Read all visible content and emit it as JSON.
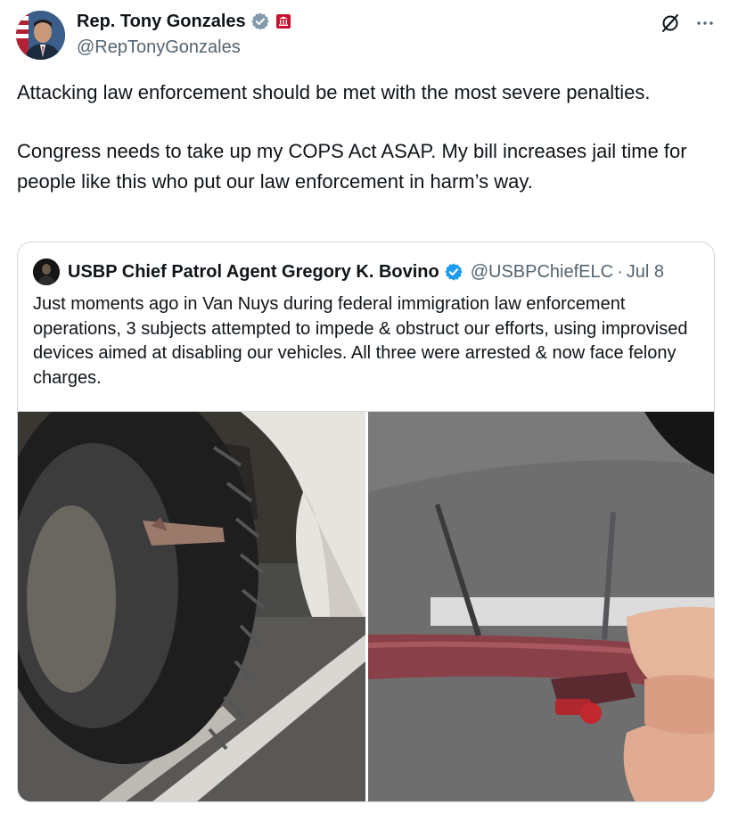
{
  "author": {
    "name": "Rep. Tony Gonzales",
    "handle": "@RepTonyGonzales"
  },
  "tweet": {
    "paragraph_1": "Attacking law enforcement should be met with the most severe penalties.",
    "paragraph_2": "Congress needs to take up my COPS Act ASAP. My bill increases jail time for people like this who put our law enforcement in harm’s way."
  },
  "quoted": {
    "name": "USBP Chief Patrol Agent Gregory K. Bovino",
    "handle": "@USBPChiefELC",
    "separator": "·",
    "date": "Jul 8",
    "text": "Just moments ago in Van Nuys during federal immigration law enforcement operations, 3 subjects attempted to impede & obstruct our efforts, using improvised devices aimed at disabling our vehicles. All three were arrested & now face felony charges."
  },
  "icons": {
    "verified": "verified-badge-icon",
    "government": "government-affiliation-icon",
    "grok": "grok-icon",
    "more": "more-options-icon"
  },
  "colors": {
    "text": "#0f1419",
    "secondary_text": "#536471",
    "verified_blue": "#1d9bf0",
    "border": "#cfd9de",
    "gov_badge_red": "#c8102e"
  }
}
